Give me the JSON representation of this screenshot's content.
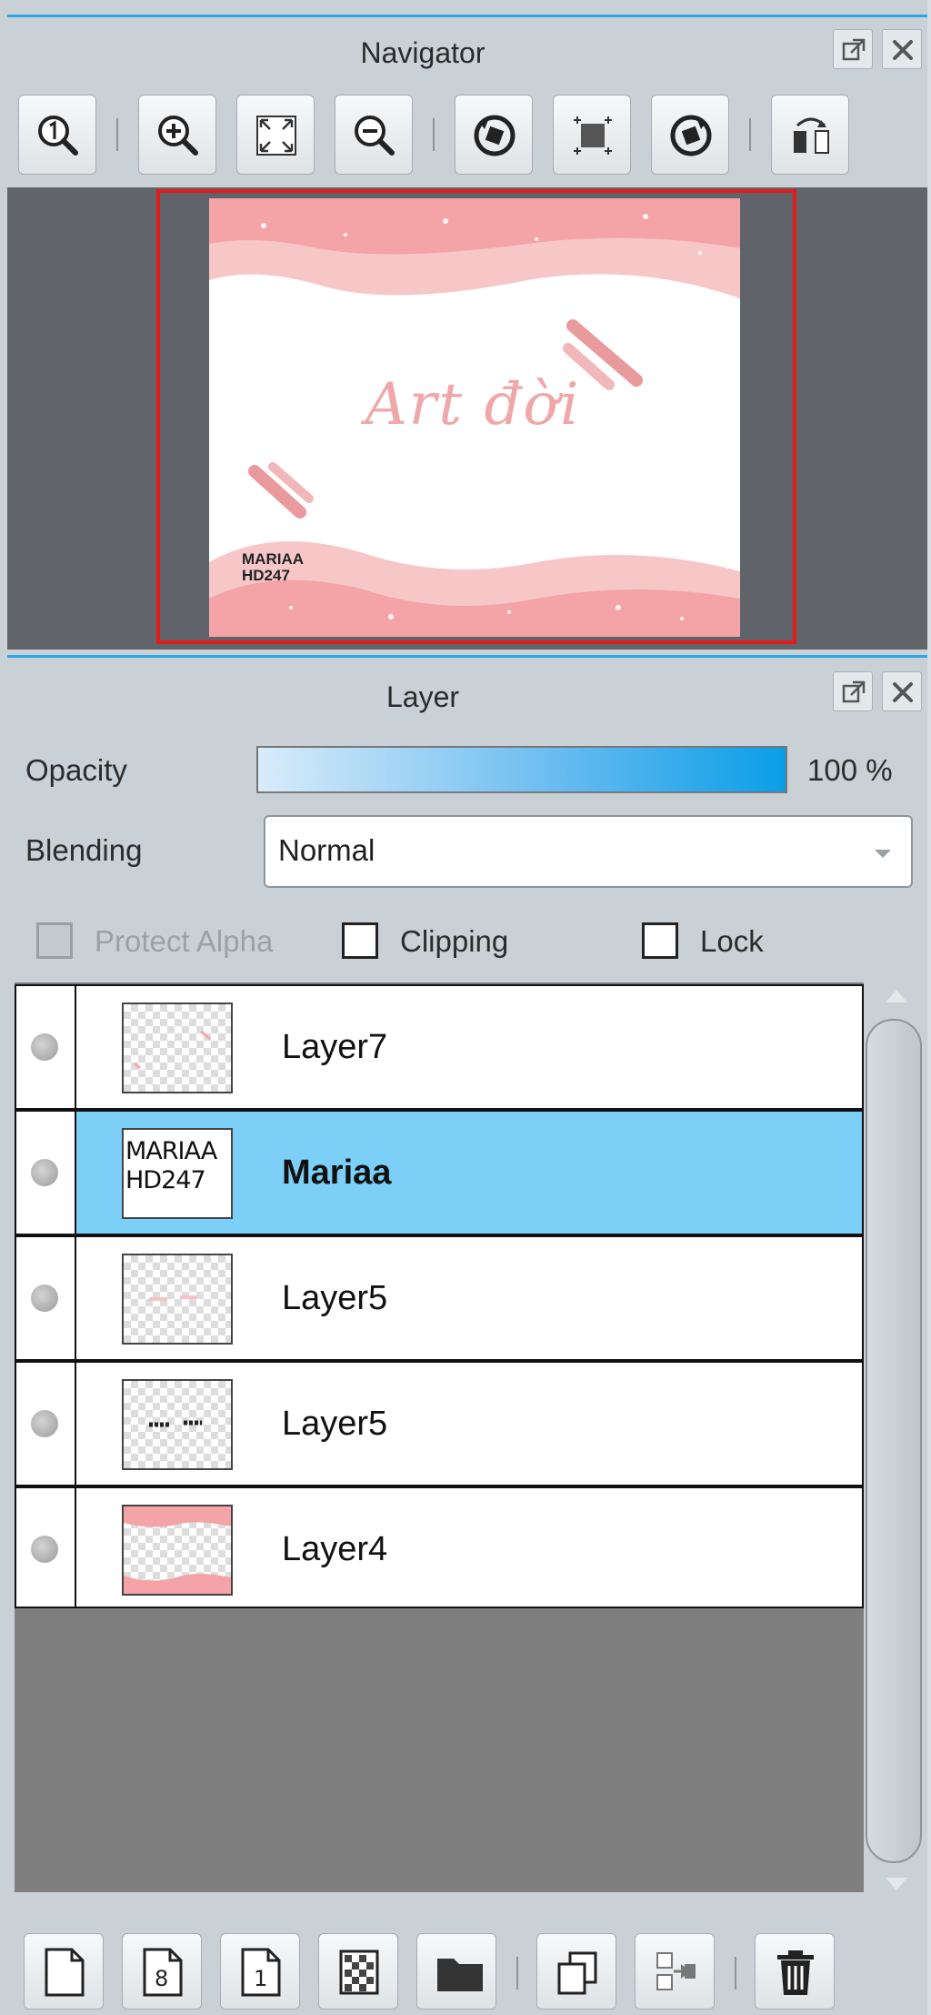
{
  "navigator": {
    "title": "Navigator",
    "toolbar": [
      "zoom-actual-icon",
      "zoom-in-icon",
      "fit-window-icon",
      "zoom-out-icon",
      "rotate-left-icon",
      "reset-rotation-icon",
      "rotate-right-icon",
      "flip-horizontal-icon"
    ],
    "preview": {
      "title_text": "Art đời",
      "signature_line1": "MARIAA",
      "signature_line2": "HD247",
      "accent_color": "#f4a3a6",
      "frame_color": "#e11a1a"
    }
  },
  "layer_panel": {
    "title": "Layer",
    "opacity_label": "Opacity",
    "opacity_value": "100 %",
    "blending_label": "Blending",
    "blending_value": "Normal",
    "protect_alpha_label": "Protect Alpha",
    "clipping_label": "Clipping",
    "lock_label": "Lock",
    "layers": [
      {
        "name": "Layer7",
        "selected": false
      },
      {
        "name": "Mariaa",
        "selected": true,
        "thumb_text_1": "MARIAA",
        "thumb_text_2": "HD247"
      },
      {
        "name": "Layer5",
        "selected": false
      },
      {
        "name": "Layer5",
        "selected": false
      },
      {
        "name": "Layer4",
        "selected": false
      }
    ],
    "selected_color": "#7ccff7",
    "bottom_toolbar": [
      "new-layer-icon",
      "new-8bit-layer-icon",
      "new-1bit-layer-icon",
      "new-halftone-layer-icon",
      "new-folder-icon",
      "duplicate-layer-icon",
      "merge-down-icon",
      "delete-layer-icon"
    ]
  }
}
